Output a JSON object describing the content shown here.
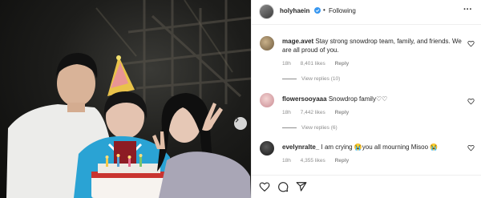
{
  "post": {
    "username": "holyhaein",
    "separator": "•",
    "follow_label": "Following",
    "more_label": "···"
  },
  "comments": [
    {
      "username": "mage.avet",
      "text": "Stay strong snowdrop team, family, and friends. We are all proud of you.",
      "age": "18h",
      "likes": "8,401 likes",
      "reply_label": "Reply",
      "view_replies": "View replies (10)"
    },
    {
      "username": "flowersooyaaa",
      "text": "Snowdrop family♡♡",
      "age": "18h",
      "likes": "7,442 likes",
      "reply_label": "Reply",
      "view_replies": "View replies (6)"
    },
    {
      "username": "evelynralte_",
      "text": "I am crying 😭you all mourning Misoo 😭",
      "age": "18h",
      "likes": "4,355 likes",
      "reply_label": "Reply"
    }
  ],
  "icons": {
    "verified": "verified-badge-icon",
    "heart": "heart-icon",
    "comment": "comment-icon",
    "share": "share-icon",
    "next": "chevron-right-icon"
  },
  "colors": {
    "verified_blue": "#3897f0",
    "muted_text": "#8e8e8e",
    "border": "#efefef"
  }
}
